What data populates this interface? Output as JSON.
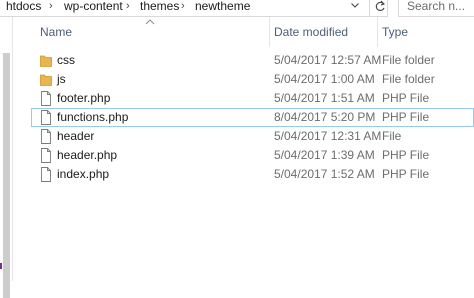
{
  "address": {
    "crumbs": [
      "htdocs",
      "wp-content",
      "themes",
      "newtheme"
    ],
    "separator": "›"
  },
  "search": {
    "placeholder": "Search n..."
  },
  "columns": {
    "name": "Name",
    "date_modified": "Date modified",
    "type": "Type"
  },
  "files": [
    {
      "name": "css",
      "date": "5/04/2017 12:57 AM",
      "type": "File folder",
      "icon": "folder-icon"
    },
    {
      "name": "js",
      "date": "5/04/2017 1:00 AM",
      "type": "File folder",
      "icon": "folder-icon"
    },
    {
      "name": "footer.php",
      "date": "5/04/2017 1:51 AM",
      "type": "PHP File",
      "icon": "file-icon"
    },
    {
      "name": "functions.php",
      "date": "8/04/2017 5:20 PM",
      "type": "PHP File",
      "icon": "file-icon"
    },
    {
      "name": "header",
      "date": "5/04/2017 12:31 AM",
      "type": "File",
      "icon": "file-icon"
    },
    {
      "name": "header.php",
      "date": "5/04/2017 1:39 AM",
      "type": "PHP File",
      "icon": "file-icon"
    },
    {
      "name": "index.php",
      "date": "5/04/2017 1:52 AM",
      "type": "PHP File",
      "icon": "file-icon"
    }
  ],
  "colors": {
    "folder": "#e8b64d",
    "header_text": "#4c607a",
    "focus_outline": "#99c9ef"
  }
}
